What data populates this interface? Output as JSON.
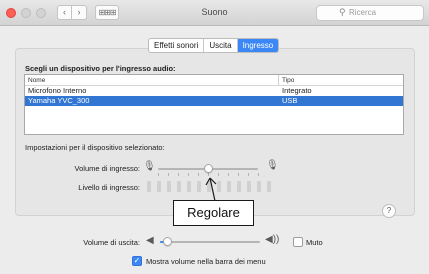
{
  "window": {
    "title": "Suono",
    "search_placeholder": "Ricerca",
    "back_glyph": "‹",
    "forward_glyph": "›",
    "grid_glyph": "⊞⊞⊞"
  },
  "tabs": [
    {
      "label": "Effetti sonori",
      "active": false
    },
    {
      "label": "Uscita",
      "active": false
    },
    {
      "label": "Ingresso",
      "active": true
    }
  ],
  "input": {
    "heading": "Scegli un dispositivo per l'ingresso audio:",
    "columns": [
      "Nome",
      "Tipo"
    ],
    "devices": [
      {
        "name": "Microfono Interno",
        "type": "Integrato",
        "selected": false
      },
      {
        "name": "Yamaha YVC_300",
        "type": "USB",
        "selected": true
      }
    ],
    "settings_label": "Impostazioni per il dispositivo selezionato:",
    "volume_label": "Volume di ingresso:",
    "volume_level": 0.5,
    "level_label": "Livello di ingresso:",
    "level_value": 0
  },
  "callout": "Regolare",
  "help_label": "?",
  "output": {
    "volume_label": "Volume di uscita:",
    "volume_level": 0.08,
    "mute_label": "Muto",
    "mute_checked": false,
    "show_in_menubar_label": "Mostra volume nella barra dei menu",
    "show_in_menubar_checked": true
  },
  "colors": {
    "accent": "#3b87f6",
    "selection": "#3276d4",
    "close": "#fc5f57"
  },
  "icons": [
    "close-light",
    "minimize-light",
    "zoom-light",
    "back-chevron",
    "forward-chevron",
    "grid",
    "search",
    "microphone",
    "speaker",
    "checkmark",
    "help"
  ]
}
